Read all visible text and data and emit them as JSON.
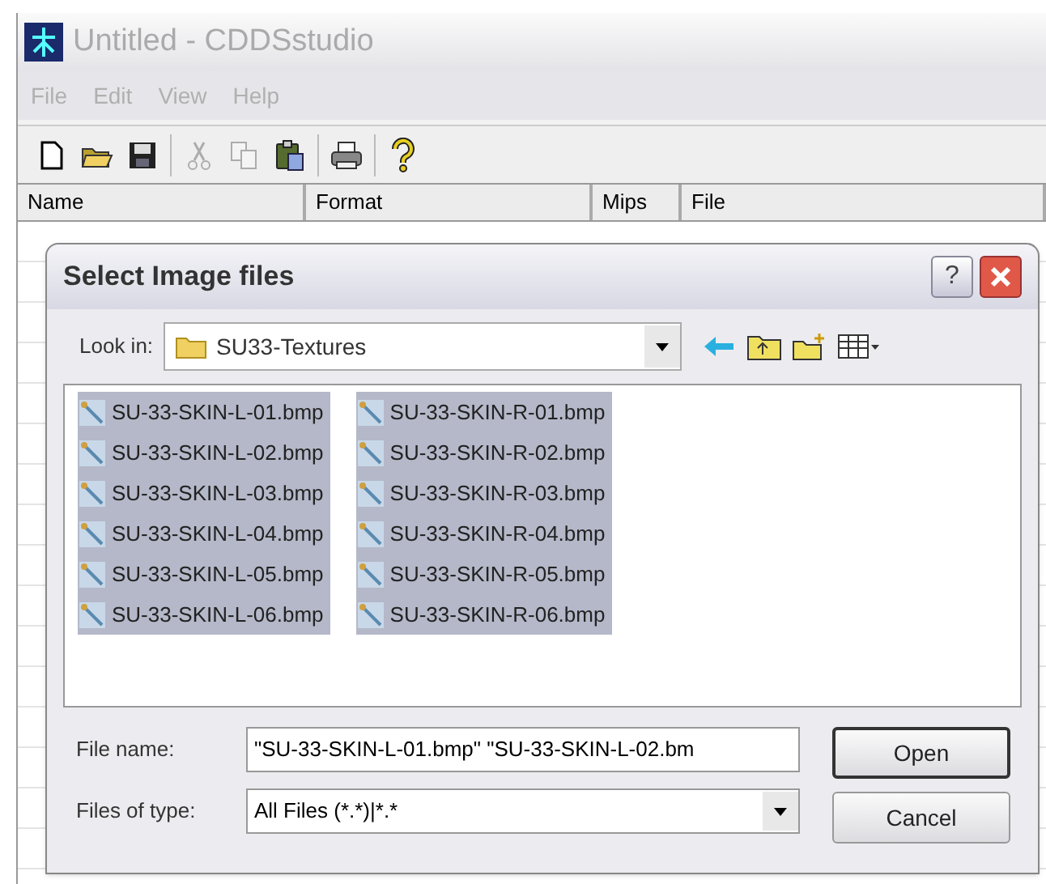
{
  "window": {
    "title": "Untitled - CDDSstudio"
  },
  "menu": [
    "File",
    "Edit",
    "View",
    "Help"
  ],
  "toolbar": [
    {
      "kind": "new",
      "disabled": false
    },
    {
      "kind": "open",
      "disabled": false
    },
    {
      "kind": "save",
      "disabled": false
    },
    {
      "kind": "cut",
      "disabled": true
    },
    {
      "kind": "copy",
      "disabled": true
    },
    {
      "kind": "paste",
      "disabled": false
    },
    {
      "kind": "print",
      "disabled": false
    },
    {
      "kind": "help",
      "disabled": false
    }
  ],
  "table": {
    "columns": [
      "Name",
      "Format",
      "Mips",
      "File"
    ]
  },
  "dialog": {
    "title": "Select Image files",
    "help_button": "?",
    "look_in": {
      "label": "Look in:",
      "value": "SU33-Textures"
    },
    "files": [
      {
        "name": "SU-33-SKIN-L-01.bmp",
        "selected": true
      },
      {
        "name": "SU-33-SKIN-L-02.bmp",
        "selected": true
      },
      {
        "name": "SU-33-SKIN-L-03.bmp",
        "selected": true
      },
      {
        "name": "SU-33-SKIN-L-04.bmp",
        "selected": true
      },
      {
        "name": "SU-33-SKIN-L-05.bmp",
        "selected": true
      },
      {
        "name": "SU-33-SKIN-L-06.bmp",
        "selected": true
      },
      {
        "name": "SU-33-SKIN-R-01.bmp",
        "selected": true
      },
      {
        "name": "SU-33-SKIN-R-02.bmp",
        "selected": true
      },
      {
        "name": "SU-33-SKIN-R-03.bmp",
        "selected": true
      },
      {
        "name": "SU-33-SKIN-R-04.bmp",
        "selected": true
      },
      {
        "name": "SU-33-SKIN-R-05.bmp",
        "selected": true
      },
      {
        "name": "SU-33-SKIN-R-06.bmp",
        "selected": true
      }
    ],
    "file_name": {
      "label": "File name:",
      "value": "\"SU-33-SKIN-L-01.bmp\" \"SU-33-SKIN-L-02.bm"
    },
    "file_type": {
      "label": "Files of type:",
      "value": "All Files (*.*)|*.*"
    },
    "buttons": [
      "Open",
      "Cancel"
    ]
  }
}
